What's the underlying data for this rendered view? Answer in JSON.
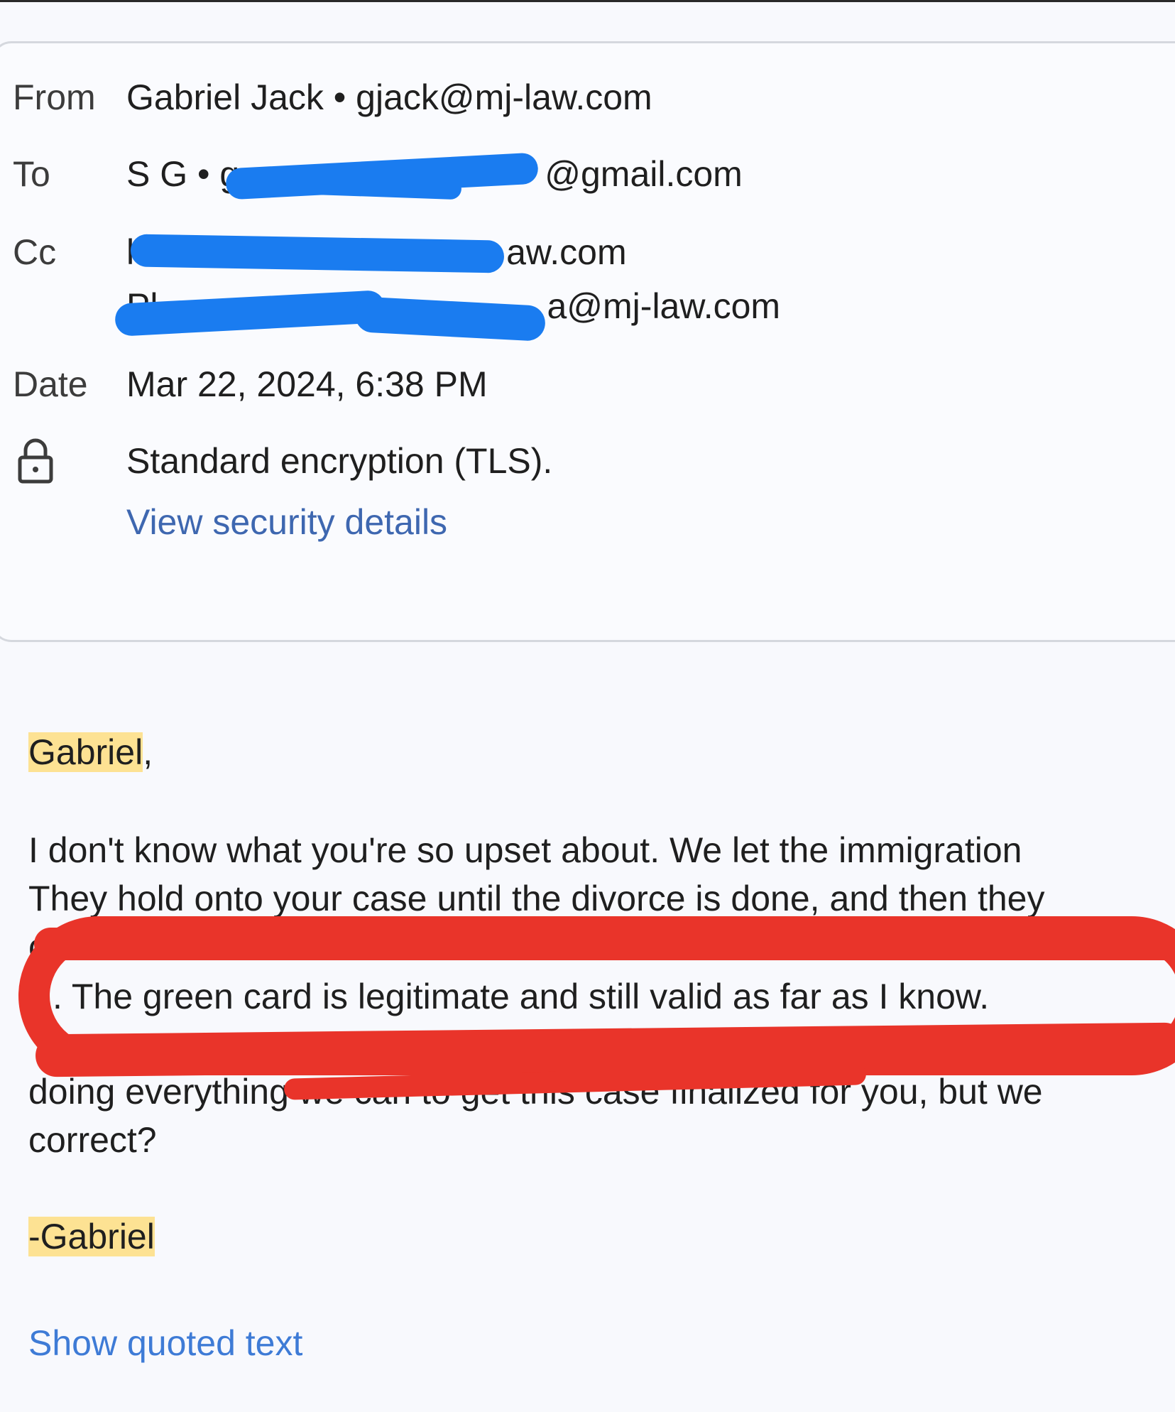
{
  "header": {
    "from_label": "From",
    "from_value": "Gabriel Jack • gjack@mj-law.com",
    "to_label": "To",
    "to_value_prefix": "S G • g",
    "to_value_suffix": "@gmail.com",
    "cc_label": "Cc",
    "cc_line1_prefix": "l",
    "cc_line1_suffix": "aw.com",
    "cc_line2_prefix": "Pl",
    "cc_line2_suffix": "a@mj-law.com",
    "date_label": "Date",
    "date_value": "Mar 22, 2024, 6:38 PM",
    "encryption_text": "Standard encryption (TLS).",
    "security_link": "View security details",
    "lock_icon": "lock-icon"
  },
  "body": {
    "greeting_name": "Gabriel",
    "greeting_punct": ",",
    "line1": "I don't know what you're so upset about.  We let the immigration",
    "line2": "They hold onto your case until the divorce is done, and then they",
    "line3_fragment": "c",
    "line4": ". The green card is legitimate and still valid as far as I know.",
    "line6": "doing everything we can to get this case finalized for you, but we",
    "line7": "correct?",
    "signoff_dash": "-",
    "signoff_name": "Gabriel",
    "show_quoted": "Show quoted text"
  },
  "colors": {
    "redaction_blue": "#1a7cf0",
    "annotation_red": "#e9342a",
    "highlight": "#fde293",
    "link": "#3e67b0"
  }
}
